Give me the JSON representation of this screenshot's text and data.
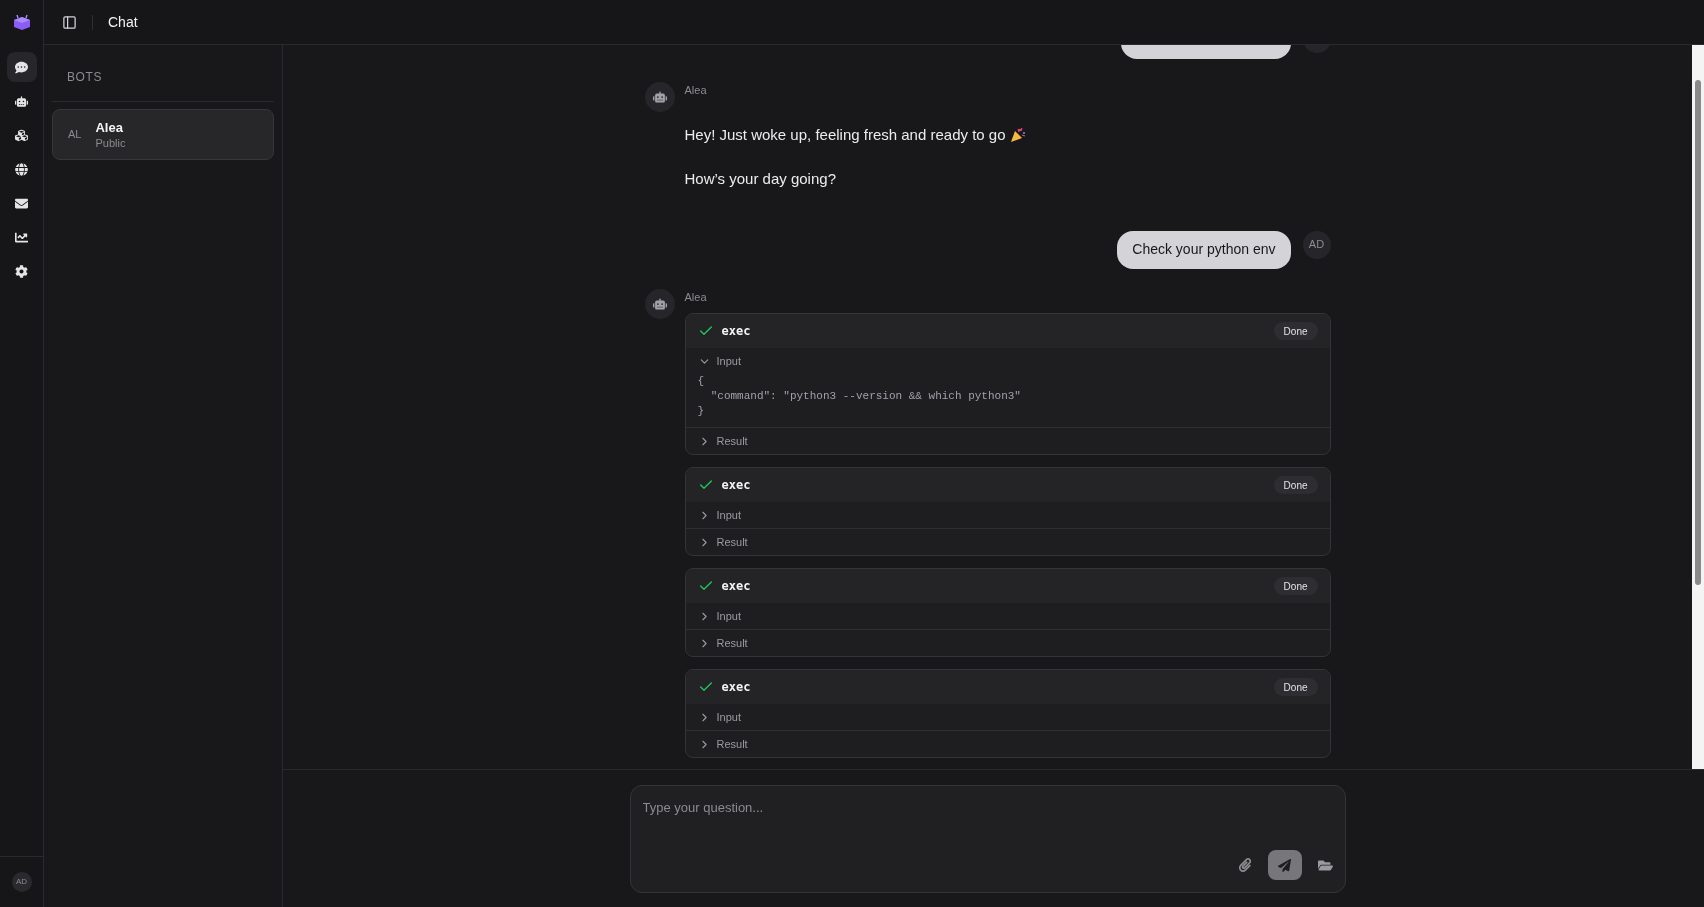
{
  "rail": {
    "items": [
      {
        "selected": true
      },
      {
        "selected": false
      },
      {
        "selected": false
      },
      {
        "selected": false
      },
      {
        "selected": false
      },
      {
        "selected": false
      },
      {
        "selected": false
      }
    ],
    "user_avatar": "AD"
  },
  "header": {
    "title": "Chat"
  },
  "bots_panel": {
    "heading": "BOTS",
    "bots": [
      {
        "initials": "AL",
        "name": "Alea",
        "subtitle": "Public",
        "selected": true
      }
    ]
  },
  "messages": [
    {
      "kind": "cut_user"
    },
    {
      "kind": "bot",
      "author": "Alea",
      "paragraphs": [
        "Hey! Just woke up, feeling fresh and ready to go",
        "How’s your day going?"
      ]
    },
    {
      "kind": "user",
      "text": "Check your python env",
      "avatar": "AD"
    },
    {
      "kind": "tools",
      "author": "Alea",
      "tools": [
        {
          "name": "exec",
          "status": "Done",
          "sections": [
            {
              "label": "Input",
              "expanded": true,
              "code": "{\n  \"command\": \"python3 --version && which python3\"\n}"
            },
            {
              "label": "Result",
              "expanded": false
            }
          ]
        },
        {
          "name": "exec",
          "status": "Done",
          "sections": [
            {
              "label": "Input",
              "expanded": false
            },
            {
              "label": "Result",
              "expanded": false
            }
          ]
        },
        {
          "name": "exec",
          "status": "Done",
          "sections": [
            {
              "label": "Input",
              "expanded": false
            },
            {
              "label": "Result",
              "expanded": false
            }
          ]
        },
        {
          "name": "exec",
          "status": "Done",
          "sections": [
            {
              "label": "Input",
              "expanded": false
            },
            {
              "label": "Result",
              "expanded": false
            }
          ]
        }
      ]
    }
  ],
  "composer": {
    "placeholder": "Type your question..."
  }
}
